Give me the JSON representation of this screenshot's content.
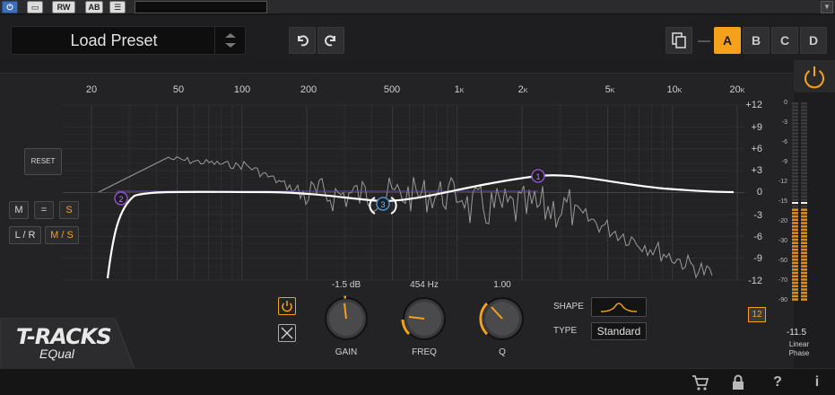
{
  "host": {
    "buttons": [
      "RW",
      "AB"
    ],
    "field_value": ""
  },
  "preset": {
    "name": "Load Preset"
  },
  "toolbar": {
    "undo_icon": "undo-icon",
    "redo_icon": "redo-icon",
    "copy_icon": "copy-icon",
    "slots": [
      "A",
      "B",
      "C",
      "D"
    ],
    "active_slot": "A"
  },
  "eq": {
    "freq_labels": [
      {
        "value": "20",
        "unit": ""
      },
      {
        "value": "50",
        "unit": ""
      },
      {
        "value": "100",
        "unit": ""
      },
      {
        "value": "200",
        "unit": ""
      },
      {
        "value": "500",
        "unit": ""
      },
      {
        "value": "1",
        "unit": "K"
      },
      {
        "value": "2",
        "unit": "K"
      },
      {
        "value": "5",
        "unit": "K"
      },
      {
        "value": "10",
        "unit": "K"
      },
      {
        "value": "20",
        "unit": "K"
      }
    ],
    "db_labels": [
      "+12",
      "+9",
      "+6",
      "+3",
      "0",
      "-3",
      "-6",
      "-9",
      "-12"
    ],
    "db_range": "12",
    "reset_label": "RESET",
    "bands": [
      {
        "id": "1",
        "color": "#8a4fc9"
      },
      {
        "id": "2",
        "color": "#8a4fc9"
      },
      {
        "id": "3",
        "color": "#4a90c9"
      }
    ],
    "mode_buttons": [
      {
        "label": "M",
        "active": false
      },
      {
        "label": "=",
        "active": false
      },
      {
        "label": "S",
        "active": true
      },
      {
        "label": "L / R",
        "active": false
      },
      {
        "label": "M / S",
        "active": true
      }
    ]
  },
  "logo": {
    "line1": "T-RACKS",
    "line2": "EQual"
  },
  "band_controls": {
    "gain": {
      "label": "GAIN",
      "value": "-1.5 dB"
    },
    "freq": {
      "label": "FREQ",
      "value": "454 Hz"
    },
    "q": {
      "label": "Q",
      "value": "1.00"
    },
    "shape_label": "SHAPE",
    "type_label": "TYPE",
    "type_value": "Standard"
  },
  "meter": {
    "scale": [
      "0",
      "-3",
      "-6",
      "-9",
      "-12",
      "-15",
      "-20",
      "-30",
      "-50",
      "-70",
      "-90"
    ],
    "value": "-11.5",
    "mode_line1": "Linear",
    "mode_line2": "Phase"
  },
  "footer": {
    "icons": [
      "cart-icon",
      "lock-icon",
      "help-icon",
      "info-icon"
    ],
    "help_glyph": "?",
    "info_glyph": "i"
  },
  "colors": {
    "accent": "#f4a21c",
    "band_purple": "#8a4fc9",
    "band_blue": "#4a90c9"
  }
}
